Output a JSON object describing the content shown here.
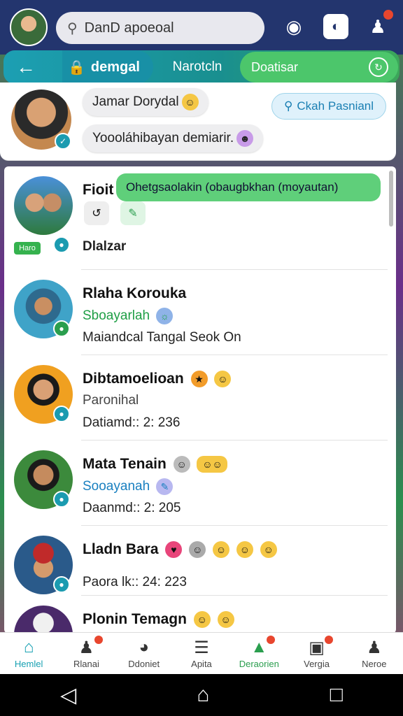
{
  "search": {
    "placeholder": "DanD apoeoal"
  },
  "tabs": {
    "active_label": "demgal",
    "middle_label": "Narotcln",
    "right_label": "Doatisar"
  },
  "profile": {
    "bubble1": "Jamar Dorydal",
    "bubble2": "Yoooláhibayan demiarir.",
    "chat_button": "Ckah Pasnianl"
  },
  "popup": {
    "text": "Ohetgsaolakin (obaugbkhan (moyautan)"
  },
  "contacts": [
    {
      "name": "Fioit",
      "line2": "",
      "line3": "Dlalzar",
      "tag": "Haro"
    },
    {
      "name": "Rlaha Korouka",
      "line2": "Sboayarlah",
      "line3": "Maiandcal Tangal Seok On"
    },
    {
      "name": "Dibtamoelioan",
      "line2": "Paronihal",
      "line3": "Datiamd:: 2: 236"
    },
    {
      "name": "Mata Tenain",
      "line2": "Sooayanah",
      "line3": "Daanmd:: 2: 205"
    },
    {
      "name": "Lladn Bara",
      "line2": "",
      "line3": "Paora lk:: 24: 223"
    },
    {
      "name": "Plonin Temagn",
      "line2": "",
      "line3": ""
    }
  ],
  "nav": [
    {
      "label": "Hemlel",
      "icon": "home-icon"
    },
    {
      "label": "Rlanai",
      "icon": "people-icon"
    },
    {
      "label": "Ddoniet",
      "icon": "compass-icon"
    },
    {
      "label": "Apita",
      "icon": "menu-icon"
    },
    {
      "label": "Deraorien",
      "icon": "alert-icon"
    },
    {
      "label": "Vergia",
      "icon": "tag-icon"
    },
    {
      "label": "Neroe",
      "icon": "person-icon"
    }
  ]
}
